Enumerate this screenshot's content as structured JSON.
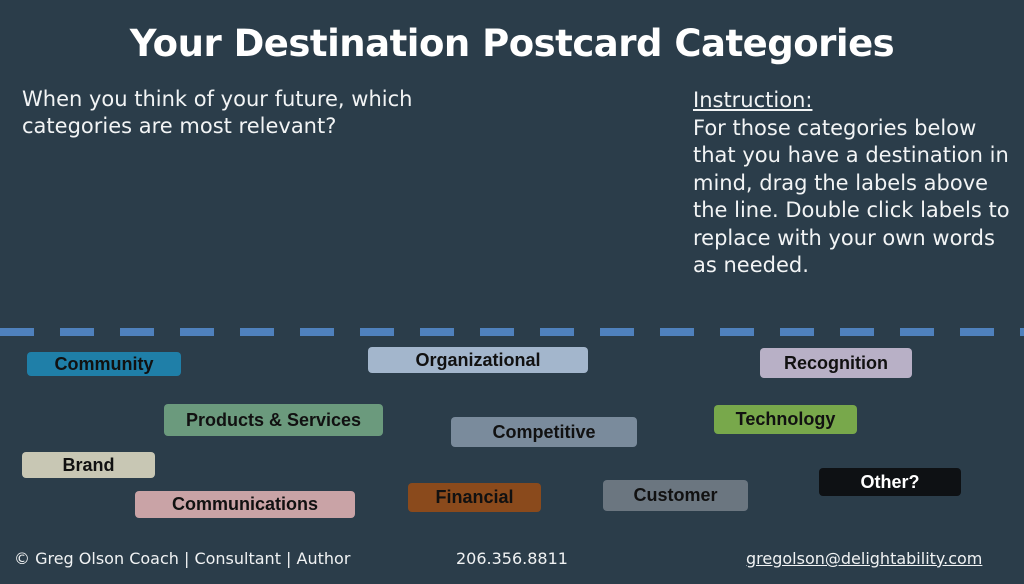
{
  "header": {
    "title": "Your Destination Postcard Categories"
  },
  "prompt": {
    "question": "When you think of your future, which categories are most relevant?"
  },
  "instruction": {
    "heading": "Instruction:",
    "body": "For those categories below that you have a destination in mind, drag the labels above the line.  Double click labels to replace  with your own words as needed."
  },
  "divider": {
    "style": "dashed",
    "color": "#4f81bd"
  },
  "labels": [
    {
      "text": "Community",
      "color": "#1f7fa8",
      "text_color": "#111111"
    },
    {
      "text": "Organizational",
      "color": "#a3b6cc",
      "text_color": "#111111"
    },
    {
      "text": "Recognition",
      "color": "#b8b0c6",
      "text_color": "#111111"
    },
    {
      "text": "Products & Services",
      "color": "#6b9a7d",
      "text_color": "#111111"
    },
    {
      "text": "Technology",
      "color": "#78a84b",
      "text_color": "#111111"
    },
    {
      "text": "Competitive",
      "color": "#7a8b9c",
      "text_color": "#111111"
    },
    {
      "text": "Brand",
      "color": "#c8c7b4",
      "text_color": "#111111"
    },
    {
      "text": "Other?",
      "color": "#0e1114",
      "text_color": "#ffffff"
    },
    {
      "text": "Financial",
      "color": "#8a4a1c",
      "text_color": "#111111"
    },
    {
      "text": "Customer",
      "color": "#6b7680",
      "text_color": "#111111"
    },
    {
      "text": "Communications",
      "color": "#c9a3a6",
      "text_color": "#111111"
    }
  ],
  "footer": {
    "credit": "©  Greg Olson  Coach | Consultant | Author",
    "phone": "206.356.8811",
    "email": "gregolson@delightability.com"
  }
}
